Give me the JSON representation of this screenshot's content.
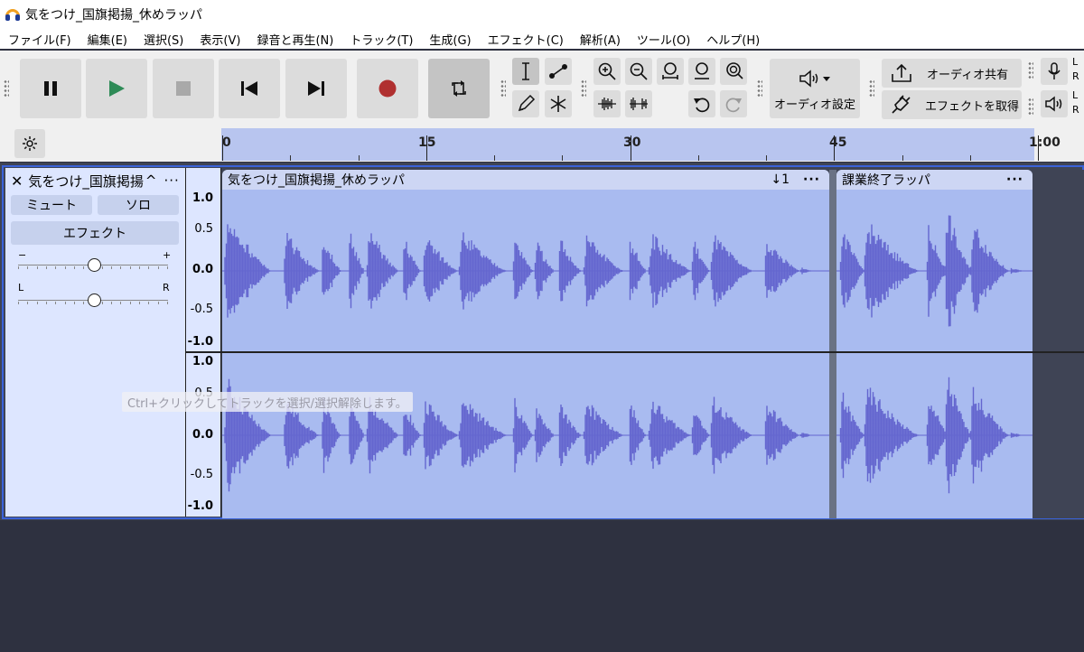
{
  "window": {
    "title": "気をつけ_国旗掲揚_休めラッパ"
  },
  "menu": [
    "ファイル(F)",
    "編集(E)",
    "選択(S)",
    "表示(V)",
    "録音と再生(N)",
    "トラック(T)",
    "生成(G)",
    "エフェクト(C)",
    "解析(A)",
    "ツール(O)",
    "ヘルプ(H)"
  ],
  "toolbar": {
    "transport": [
      "pause-icon",
      "play-icon",
      "stop-icon",
      "skip-start-icon",
      "skip-end-icon",
      "record-icon",
      "loop-icon"
    ],
    "audio_setup_label": "オーディオ設定",
    "share_audio_label": "オーディオ共有",
    "get_effects_label": "エフェクトを取得",
    "meter_labels": {
      "l": "L",
      "r": "R"
    },
    "colors": {
      "record": "#b03030",
      "play": "#2e8b57"
    }
  },
  "timeline": {
    "ticks": [
      "0",
      "15",
      "30",
      "45",
      "1:00"
    ]
  },
  "track": {
    "name": "気をつけ_国旗掲揚",
    "mute_label": "ミュート",
    "solo_label": "ソロ",
    "effects_label": "エフェクト",
    "gain_minus": "−",
    "gain_plus": "+",
    "pan_left": "L",
    "pan_right": "R",
    "scale": [
      "1.0",
      "0.5",
      "0.0",
      "-0.5",
      "-1.0"
    ]
  },
  "clips": [
    {
      "name": "気をつけ_国旗掲揚_休めラッパ",
      "badge": "↓1"
    },
    {
      "name": "課業終了ラッパ"
    }
  ],
  "tooltip": "Ctrl+クリックしてトラックを選択/選択解除します。",
  "colors": {
    "waveform": "#6466cf",
    "clip_bg": "#a9bbf0",
    "selection": "#b8c5ef"
  }
}
